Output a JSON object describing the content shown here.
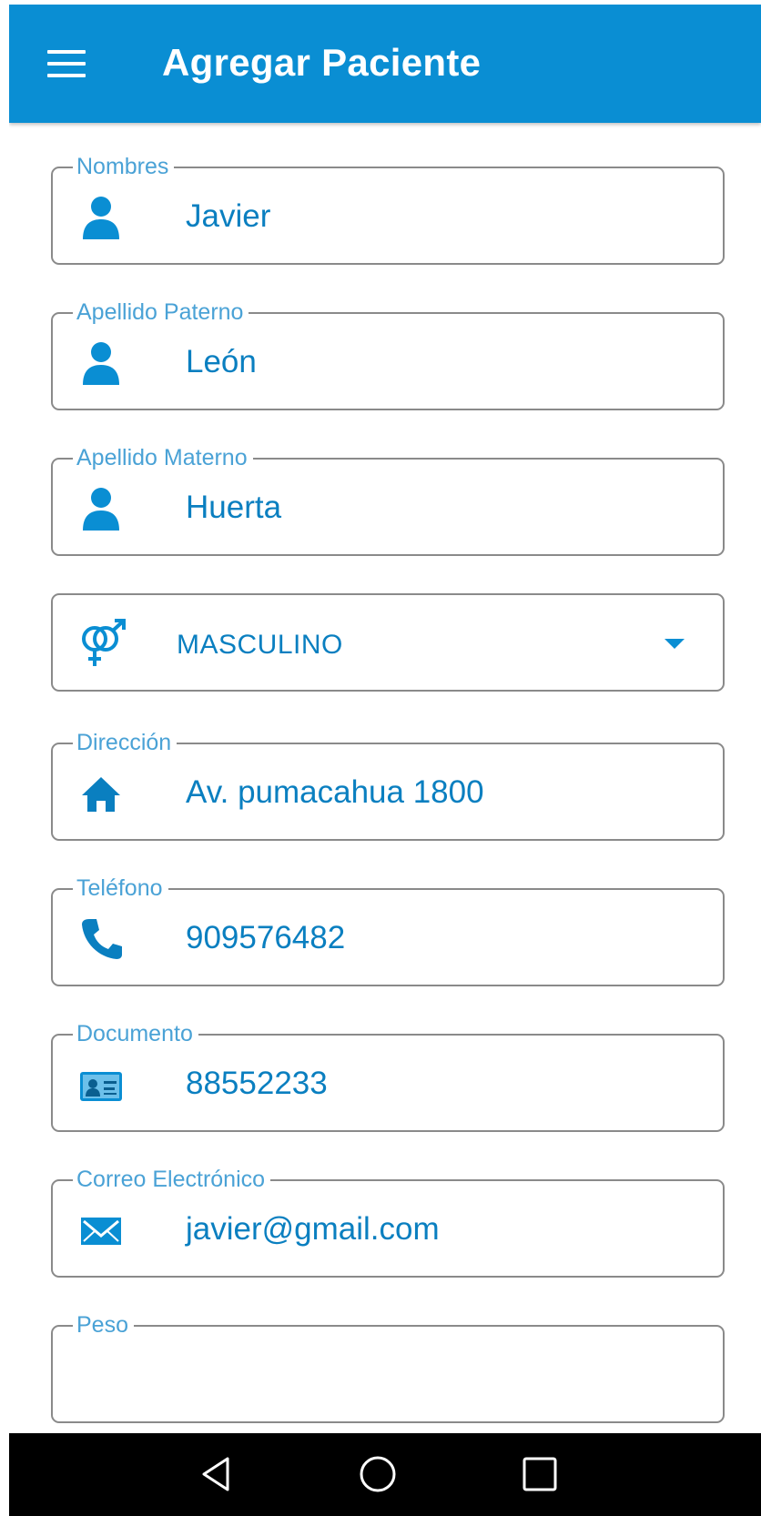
{
  "app_bar": {
    "title": "Agregar Paciente",
    "menu_icon": "hamburger-menu-icon",
    "color": "#0a8ed3"
  },
  "form": {
    "nombres": {
      "label": "Nombres",
      "value": "Javier",
      "icon": "person-icon"
    },
    "apellido_paterno": {
      "label": "Apellido Paterno",
      "value": "León",
      "icon": "person-icon"
    },
    "apellido_materno": {
      "label": "Apellido Materno",
      "value": "Huerta",
      "icon": "person-icon"
    },
    "sexo": {
      "value": "MASCULINO",
      "icon": "gender-icon"
    },
    "direccion": {
      "label": "Dirección",
      "value": "Av. pumacahua 1800",
      "icon": "home-icon"
    },
    "telefono": {
      "label": "Teléfono",
      "value": "909576482",
      "icon": "phone-icon"
    },
    "documento": {
      "label": "Documento",
      "value": "88552233",
      "icon": "id-card-icon"
    },
    "correo": {
      "label": "Correo Electrónico",
      "value": "javier@gmail.com",
      "icon": "email-icon"
    },
    "peso": {
      "label": "Peso",
      "value": ""
    }
  },
  "nav_bar": {
    "back": "back-icon",
    "home": "home-circle-icon",
    "recents": "recents-icon"
  },
  "colors": {
    "accent": "#0a8ed3",
    "value_text": "#0a7fc0",
    "label_text": "#4aa2d6",
    "border": "#8a8a8a"
  }
}
